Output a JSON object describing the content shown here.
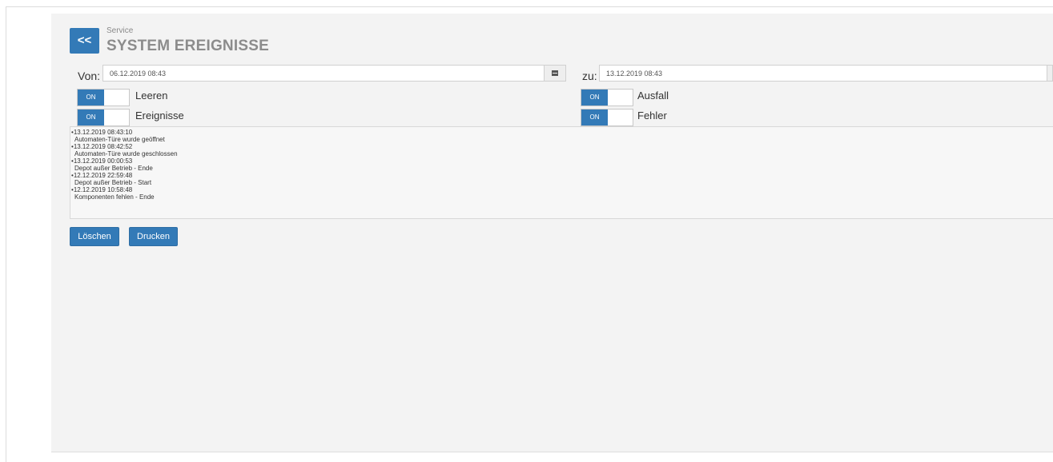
{
  "header": {
    "back_label": "<<",
    "section": "Service",
    "title": "SYSTEM EREIGNISSE"
  },
  "filter": {
    "from_label": "Von:",
    "from_value": "06.12.2019 08:43",
    "to_label": "zu:",
    "to_value": "13.12.2019 08:43"
  },
  "toggles": [
    {
      "label": "Leeren",
      "state": "ON"
    },
    {
      "label": "Ausfall",
      "state": "ON"
    },
    {
      "label": "Ereignisse",
      "state": "ON"
    },
    {
      "label": "Fehler",
      "state": "ON"
    }
  ],
  "events": [
    {
      "time": "13.12.2019 08:43:10",
      "message": "Automaten-Türe wurde geöffnet"
    },
    {
      "time": "13.12.2019 08:42:52",
      "message": "Automaten-Türe wurde geschlossen"
    },
    {
      "time": "13.12.2019 00:00:53",
      "message": "Depot außer Betrieb - Ende"
    },
    {
      "time": "12.12.2019 22:59:48",
      "message": "Depot außer Betrieb - Start"
    },
    {
      "time": "12.12.2019 10:58:48",
      "message": "Komponenten fehlen - Ende"
    }
  ],
  "actions": {
    "delete_label": "Löschen",
    "print_label": "Drucken"
  },
  "colors": {
    "accent": "#337ab7",
    "panel": "#f3f3f3"
  }
}
